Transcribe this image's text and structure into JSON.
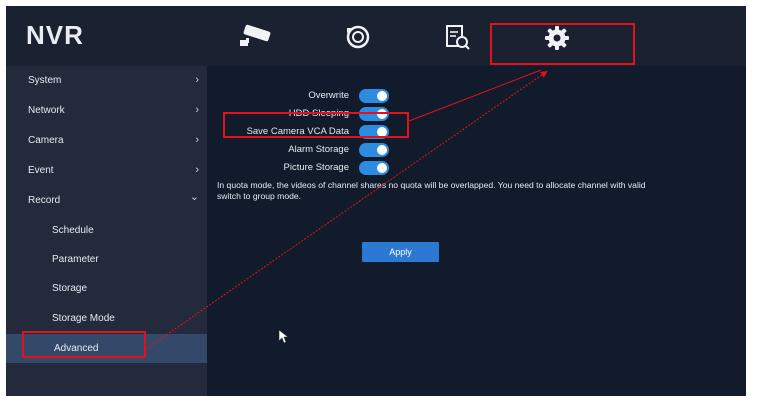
{
  "app": {
    "title": "NVR"
  },
  "nav": [
    {
      "name": "camera-icon"
    },
    {
      "name": "playback-icon"
    },
    {
      "name": "search-icon"
    },
    {
      "name": "gear-icon"
    }
  ],
  "sidebar": {
    "items": [
      {
        "label": "System",
        "chevron": "›"
      },
      {
        "label": "Network",
        "chevron": "›"
      },
      {
        "label": "Camera",
        "chevron": "›"
      },
      {
        "label": "Event",
        "chevron": "›"
      },
      {
        "label": "Record",
        "chevron": "⌄"
      },
      {
        "label": "Schedule"
      },
      {
        "label": "Parameter"
      },
      {
        "label": "Storage"
      },
      {
        "label": "Storage Mode"
      },
      {
        "label": "Advanced"
      }
    ]
  },
  "settings": {
    "options": [
      {
        "label": "Overwrite",
        "enabled": true
      },
      {
        "label": "HDD Sleeping",
        "enabled": true
      },
      {
        "label": "Save Camera VCA Data",
        "enabled": true
      },
      {
        "label": "Alarm Storage",
        "enabled": true
      },
      {
        "label": "Picture Storage",
        "enabled": true
      }
    ],
    "note_line1": "In quota mode, the videos of channel shares no quota will be overlapped. You need to allocate channel with valid",
    "note_line2": "switch to group mode.",
    "apply_label": "Apply"
  },
  "colors": {
    "accent": "#2b8ce0",
    "highlight": "#e2121c",
    "sidebar_active": "#34496a"
  }
}
